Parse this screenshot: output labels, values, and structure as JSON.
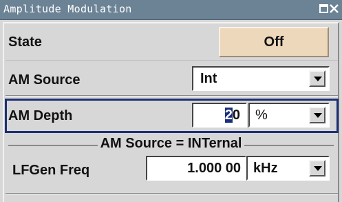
{
  "window": {
    "title": "Amplitude Modulation"
  },
  "rows": {
    "state": {
      "label": "State",
      "value": "Off"
    },
    "am_source": {
      "label": "AM Source",
      "value": "Int"
    },
    "am_depth": {
      "label": "AM Depth",
      "value_prefix": "",
      "value_cursor": "2",
      "value_suffix": "0",
      "unit": "%"
    },
    "group_title": "AM Source = INTernal",
    "lfgen_freq": {
      "label": "LFGen Freq",
      "value": "1.000 00",
      "unit": "kHz"
    }
  },
  "icons": {
    "maximize": "maximize-icon",
    "close": "close-icon",
    "dropdown": "chevron-down-icon"
  },
  "colors": {
    "titlebar": "#6c8396",
    "panel": "#d7d7d7",
    "state_button": "#eed8bc",
    "focus_frame": "#1d2f73"
  }
}
